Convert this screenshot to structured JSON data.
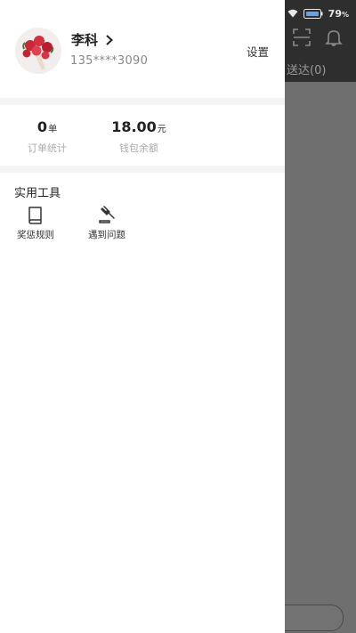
{
  "status_bar": {
    "battery": "79",
    "battery_unit": "%"
  },
  "background_page": {
    "tab_label": "送达(0)"
  },
  "drawer": {
    "user": {
      "name": "李科",
      "phone": "135****3090"
    },
    "settings_label": "设置",
    "stats": {
      "orders": {
        "value": "0",
        "unit": "单",
        "label": "订单统计"
      },
      "wallet": {
        "value": "18.00",
        "unit": "元",
        "label": "钱包余额"
      }
    },
    "tools": {
      "title": "实用工具",
      "items": [
        {
          "label": "奖惩规则",
          "icon": "book-icon"
        },
        {
          "label": "遇到问题",
          "icon": "gavel-icon"
        }
      ]
    }
  },
  "colors": {
    "drawer_bg": "#ffffff",
    "overlay": "#6e6e6e",
    "header_dark": "#2e2e2e",
    "divider": "#f4f4f4"
  }
}
